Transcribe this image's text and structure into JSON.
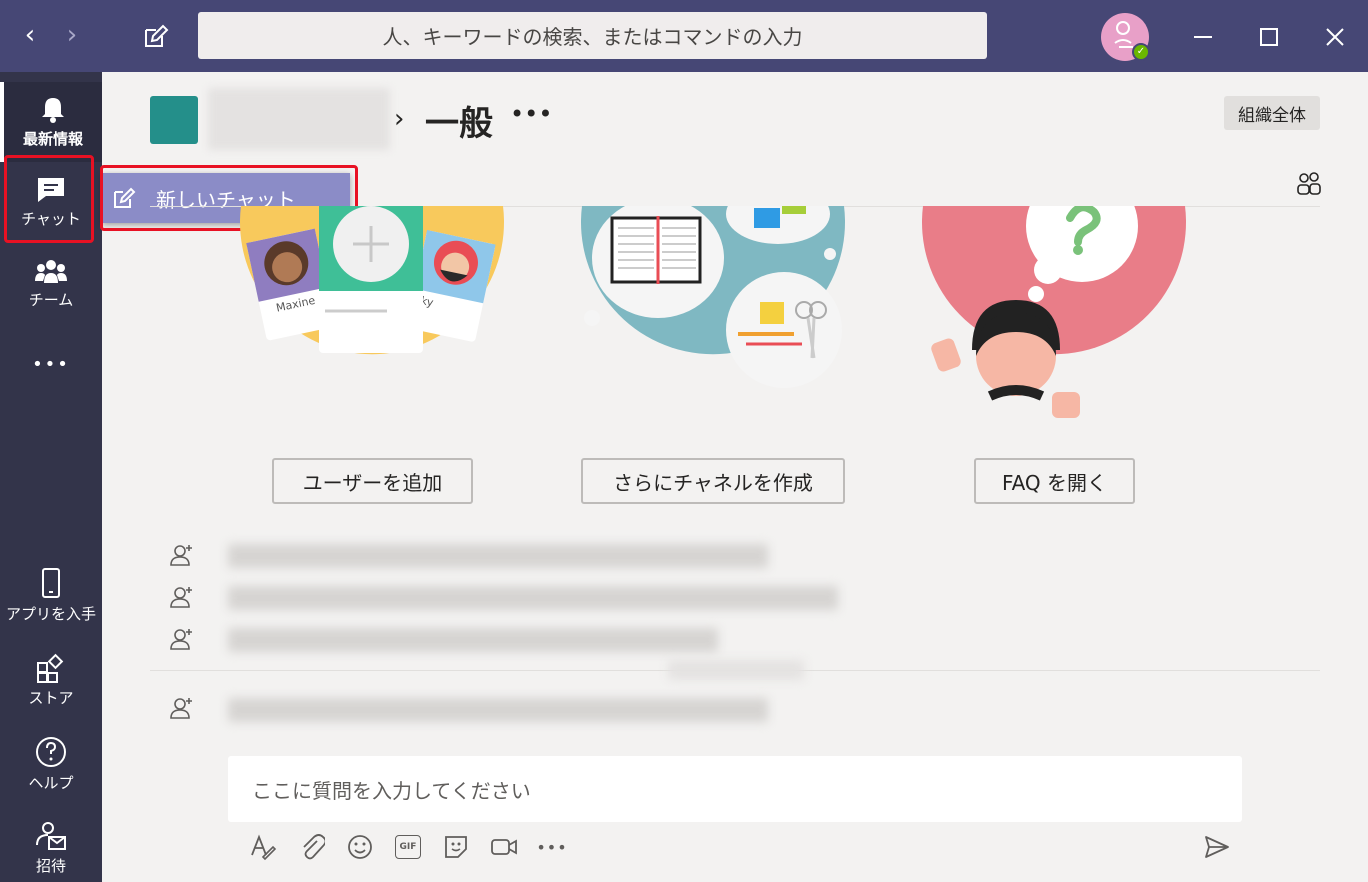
{
  "titlebar": {
    "back": "‹",
    "forward": "›",
    "search_placeholder": "人、キーワードの検索、またはコマンドの入力"
  },
  "rail": {
    "activity": "最新情報",
    "chat": "チャット",
    "teams": "チーム",
    "more": "•••",
    "get_app": "アプリを入手",
    "store": "ストア",
    "help": "ヘルプ",
    "invite": "招待"
  },
  "new_chat": {
    "label": "新しいチャット"
  },
  "channel": {
    "arrow": "›",
    "name": "一般",
    "more": "•••",
    "org_wide": "組織全体"
  },
  "illustrations": {
    "card_name_1": "Maxine",
    "card_name_2": "ky"
  },
  "actions": {
    "add_users": "ユーザーを追加",
    "create_channels": "さらにチャネルを作成",
    "open_faq": "FAQ を開く"
  },
  "composer": {
    "placeholder": "ここに質問を入力してください",
    "gif": "GIF",
    "more": "•••"
  },
  "colors": {
    "titlebar": "#464775",
    "rail": "#33344a",
    "accent": "#8b8cc7",
    "highlight": "#e81123"
  }
}
